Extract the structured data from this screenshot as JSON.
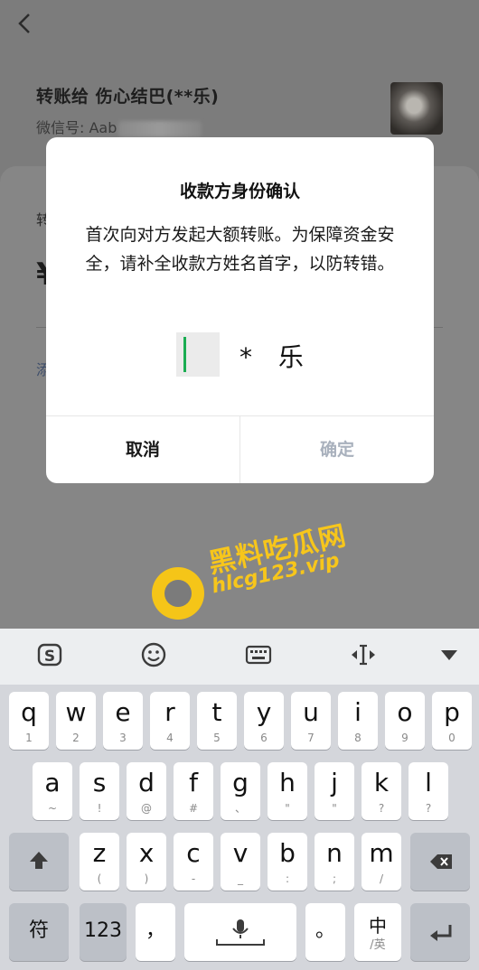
{
  "background": {
    "to_label": "转账给 伤心结巴(**乐)",
    "wechat_id": "微信号: Aab",
    "amount_label": "转",
    "currency": "¥",
    "add_note": "添"
  },
  "dialog": {
    "title": "收款方身份确认",
    "body": "首次向对方发起大额转账。为保障资金安全，请补全收款方姓名首字，以防转错。",
    "name_masked": "* 乐",
    "cancel_label": "取消",
    "confirm_label": "确定"
  },
  "watermark": {
    "name": "黑料吃瓜网",
    "url": "hlcg123.vip"
  },
  "keyboard": {
    "toolbar_icons": [
      "sogou-logo-icon",
      "emoji-icon",
      "keyboard-icon",
      "cursor-move-icon",
      "collapse-keyboard-icon"
    ],
    "row1": [
      [
        "q",
        "1"
      ],
      [
        "w",
        "2"
      ],
      [
        "e",
        "3"
      ],
      [
        "r",
        "4"
      ],
      [
        "t",
        "5"
      ],
      [
        "y",
        "6"
      ],
      [
        "u",
        "7"
      ],
      [
        "i",
        "8"
      ],
      [
        "o",
        "9"
      ],
      [
        "p",
        "0"
      ]
    ],
    "row2": [
      [
        "a",
        "~"
      ],
      [
        "s",
        "!"
      ],
      [
        "d",
        "@"
      ],
      [
        "f",
        "#"
      ],
      [
        "g",
        "、"
      ],
      [
        "h",
        "\""
      ],
      [
        "j",
        "\""
      ],
      [
        "k",
        "?"
      ],
      [
        "l",
        "?"
      ]
    ],
    "row3": [
      [
        "z",
        "("
      ],
      [
        "x",
        ")"
      ],
      [
        "c",
        "-"
      ],
      [
        "v",
        "_"
      ],
      [
        "b",
        ":"
      ],
      [
        "n",
        ";"
      ],
      [
        "m",
        "/"
      ]
    ],
    "symbol_key": "符",
    "number_key": "123",
    "comma_key": "，",
    "period_key": "。",
    "lang_key_main": "中",
    "lang_key_sub": "/英"
  }
}
